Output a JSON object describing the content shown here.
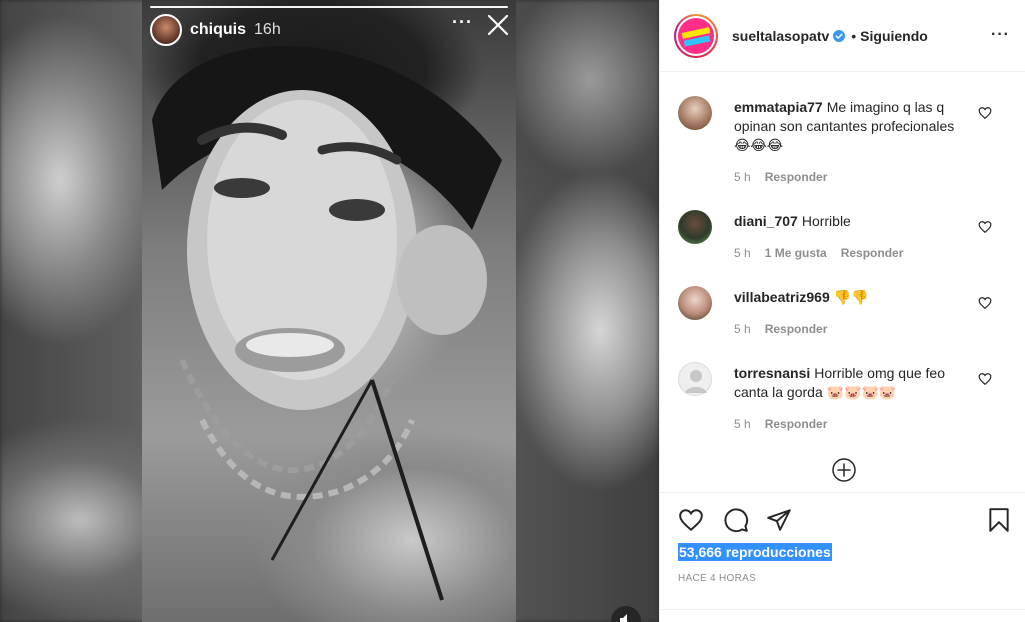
{
  "story": {
    "username": "chiquis",
    "time": "16h"
  },
  "post": {
    "account": "sueltalasopatv",
    "separator": "•",
    "follow_status": "Siguiendo"
  },
  "comments": [
    {
      "user": "emmatapia77",
      "text": "Me imagino q las q opinan son cantantes profecionales 😂😂😂",
      "age": "5 h",
      "likes": "",
      "reply": "Responder"
    },
    {
      "user": "diani_707",
      "text": "Horrible",
      "age": "5 h",
      "likes": "1 Me gusta",
      "reply": "Responder"
    },
    {
      "user": "villabeatriz969",
      "text": "👎👎",
      "age": "5 h",
      "likes": "",
      "reply": "Responder"
    },
    {
      "user": "torresnansi",
      "text": "Horrible omg que feo canta la gorda 🐷🐷🐷🐷",
      "age": "5 h",
      "likes": "",
      "reply": "Responder"
    }
  ],
  "stats": {
    "views": "53,666 reproducciones",
    "posted": "HACE 4 HORAS"
  },
  "colors": {
    "selection": "#3390ff",
    "muted": "#8e8e8e",
    "text": "#262626",
    "verified": "#3897f0"
  },
  "icons": [
    "more-icon",
    "close-icon",
    "heart-icon",
    "comment-icon",
    "share-icon",
    "bookmark-icon",
    "add-more-comments-icon",
    "verified-icon",
    "sound-icon"
  ]
}
